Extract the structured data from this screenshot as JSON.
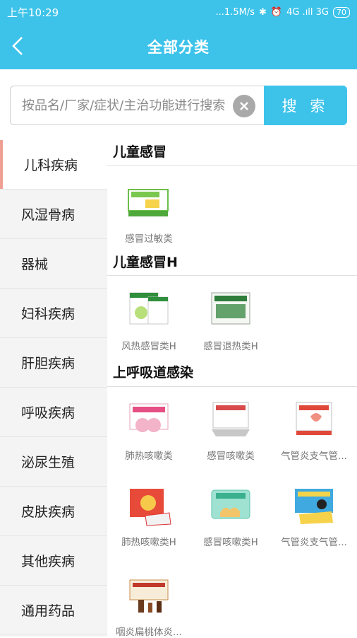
{
  "statusbar": {
    "time": "上午10:29",
    "net": "...1.5M/s",
    "signal": "4G .ıll 3G",
    "battery": "70"
  },
  "header": {
    "title": "全部分类"
  },
  "search": {
    "placeholder": "按品名/厂家/症状/主治功能进行搜索",
    "button": "搜 索"
  },
  "sidebar": {
    "items": [
      {
        "label": "儿科疾病"
      },
      {
        "label": "风湿骨病"
      },
      {
        "label": "器械"
      },
      {
        "label": "妇科疾病"
      },
      {
        "label": "肝胆疾病"
      },
      {
        "label": "呼吸疾病"
      },
      {
        "label": "泌尿生殖"
      },
      {
        "label": "皮肤疾病"
      },
      {
        "label": "其他疾病"
      },
      {
        "label": "通用药品"
      }
    ]
  },
  "sections": [
    {
      "title": "儿童感冒",
      "products": [
        {
          "label": "感冒过敏类"
        }
      ]
    },
    {
      "title": "儿童感冒H",
      "products": [
        {
          "label": "风热感冒类H"
        },
        {
          "label": "感冒退热类H"
        }
      ]
    },
    {
      "title": "上呼吸道感染",
      "products": [
        {
          "label": "肺热咳嗽类"
        },
        {
          "label": "感冒咳嗽类"
        },
        {
          "label": "气管炎支气管..."
        },
        {
          "label": "肺热咳嗽类H"
        },
        {
          "label": "感冒咳嗽类H"
        },
        {
          "label": "气管炎支气管..."
        },
        {
          "label": "咽炎扁桃体炎..."
        }
      ]
    }
  ],
  "colors": {
    "accent": "#3dc3ea",
    "active_marker": "#f0a093",
    "sidebar_bg": "#f4f4f4"
  }
}
